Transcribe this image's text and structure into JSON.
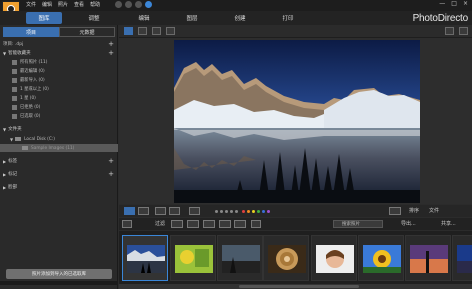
{
  "menu": [
    "文件",
    "编辑",
    "照片",
    "查看",
    "帮助"
  ],
  "modules": [
    {
      "label": "图库",
      "active": true
    },
    {
      "label": "调整",
      "active": false
    },
    {
      "label": "编辑",
      "active": false
    },
    {
      "label": "图层",
      "active": false
    },
    {
      "label": "创建",
      "active": false
    },
    {
      "label": "打印",
      "active": false
    }
  ],
  "brand": "PhotoDirecto",
  "window_buttons": {
    "minimize": "—",
    "maximize": "□",
    "close": "×"
  },
  "left_tabs": [
    {
      "label": "项目",
      "active": true
    },
    {
      "label": "元数据",
      "active": false
    }
  ],
  "project_row": {
    "label": "项目: .dpj",
    "plus": "+"
  },
  "smart_collections": {
    "title": "智能收藏夹",
    "items": [
      "所有照片 (11)",
      "最近编辑 (0)",
      "最新导入 (0)",
      "1 星或以上 (0)",
      "1 星 (0)",
      "已拒绝 (0)",
      "已选取 (0)"
    ]
  },
  "folders": {
    "title": "文件夹",
    "items": [
      {
        "label": "Local Disk (C:)",
        "selected": false
      },
      {
        "label": "Sample Images (11)",
        "selected": true
      }
    ]
  },
  "tags": {
    "title": "标签",
    "plus": "+"
  },
  "marks": {
    "title": "标记",
    "plus": "+"
  },
  "faces": {
    "title": "脸部"
  },
  "import_button": "照片添加到导入的已选取库",
  "sort": {
    "label": "排序",
    "value": "文件"
  },
  "filter_label": "过滤",
  "search_placeholder": "搜索照片",
  "export_label": "导出...",
  "share_label": "共享...",
  "color_labels": [
    "#e04040",
    "#f08a20",
    "#e8d020",
    "#40b040",
    "#3a6fd8",
    "#a050d0"
  ]
}
